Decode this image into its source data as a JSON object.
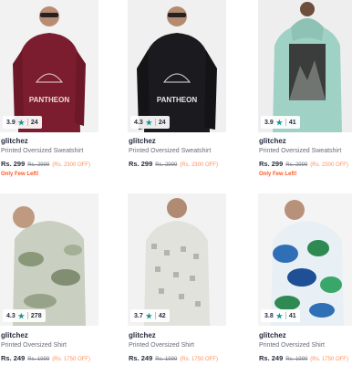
{
  "products": [
    {
      "brand": "glitchez",
      "title": "Printed Oversized Sweatshirt",
      "price": "Rs. 299",
      "mrp": "Rs. 2999",
      "discount": "(Rs. 2300 OFF)",
      "rating": "3.9",
      "rating_count": "24",
      "stock_note": "Only Few Left!",
      "garment_color": "#7b1d2e"
    },
    {
      "brand": "glitchez",
      "title": "Printed Oversized Sweatshirt",
      "price": "Rs. 299",
      "mrp": "Rs. 2999",
      "discount": "(Rs. 2300 OFF)",
      "rating": "4.3",
      "rating_count": "24",
      "stock_note": "",
      "garment_color": "#1b1b1f"
    },
    {
      "brand": "glitchez",
      "title": "Printed Oversized Sweatshirt",
      "price": "Rs. 299",
      "mrp": "Rs. 2999",
      "discount": "(Rs. 2300 OFF)",
      "rating": "3.9",
      "rating_count": "41",
      "stock_note": "Only Few Left!",
      "garment_color": "#9fd1c4"
    },
    {
      "brand": "glitchez",
      "title": "Printed Oversized Shirt",
      "price": "Rs. 249",
      "mrp": "Rs. 1999",
      "discount": "(Rs. 1750 OFF)",
      "rating": "4.3",
      "rating_count": "278",
      "stock_note": "",
      "garment_color": "#c9cfc1"
    },
    {
      "brand": "glitchez",
      "title": "Printed Oversized Shirt",
      "price": "Rs. 249",
      "mrp": "Rs. 1999",
      "discount": "(Rs. 1750 OFF)",
      "rating": "3.7",
      "rating_count": "42",
      "stock_note": "",
      "garment_color": "#e2e2dd"
    },
    {
      "brand": "glitchez",
      "title": "Printed Oversized Shirt",
      "price": "Rs. 249",
      "mrp": "Rs. 1999",
      "discount": "(Rs. 1750 OFF)",
      "rating": "3.8",
      "rating_count": "41",
      "stock_note": "",
      "garment_color": "#2f6fb6"
    }
  ],
  "colors": {
    "rating_star": "#14958f",
    "discount": "#ff905a",
    "stock_warning": "#ff5722"
  }
}
